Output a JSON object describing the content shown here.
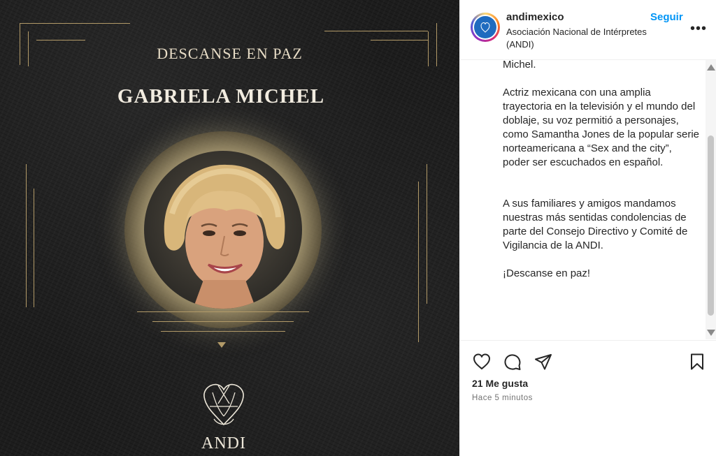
{
  "post_image": {
    "heading_small": "DESCANSE EN PAZ",
    "heading_big": "GABRIELA MICHEL",
    "logo_text": "ANDI",
    "accent_color": "#b29a68"
  },
  "header": {
    "username": "andimexico",
    "subtitle": "Asociación Nacional de Intérpretes (ANDI)",
    "follow_label": "Seguir",
    "more_label": "•••",
    "avatar_icon": "andi-logo-avatar"
  },
  "caption": {
    "top_fragment": "Michel.",
    "paragraph_1": "Actriz mexicana con una amplia trayectoria en la televisión y el mundo del doblaje, su voz permitió a personajes, como Samantha Jones de la popular serie norteamericana a “Sex and the city”, poder ser escuchados en español.",
    "paragraph_2": "A sus familiares y amigos mandamos nuestras más sentidas condolencias de parte del Consejo Directivo y Comité de Vigilancia de la ANDI.",
    "paragraph_3": "¡Descanse en paz!"
  },
  "actions": {
    "icons": [
      "heart-icon",
      "comment-icon",
      "share-icon",
      "bookmark-icon"
    ],
    "likes": "21 Me gusta",
    "time": "Hace 5 minutos"
  },
  "colors": {
    "link_blue": "#0095f6",
    "text": "#262626",
    "muted": "#737373"
  }
}
